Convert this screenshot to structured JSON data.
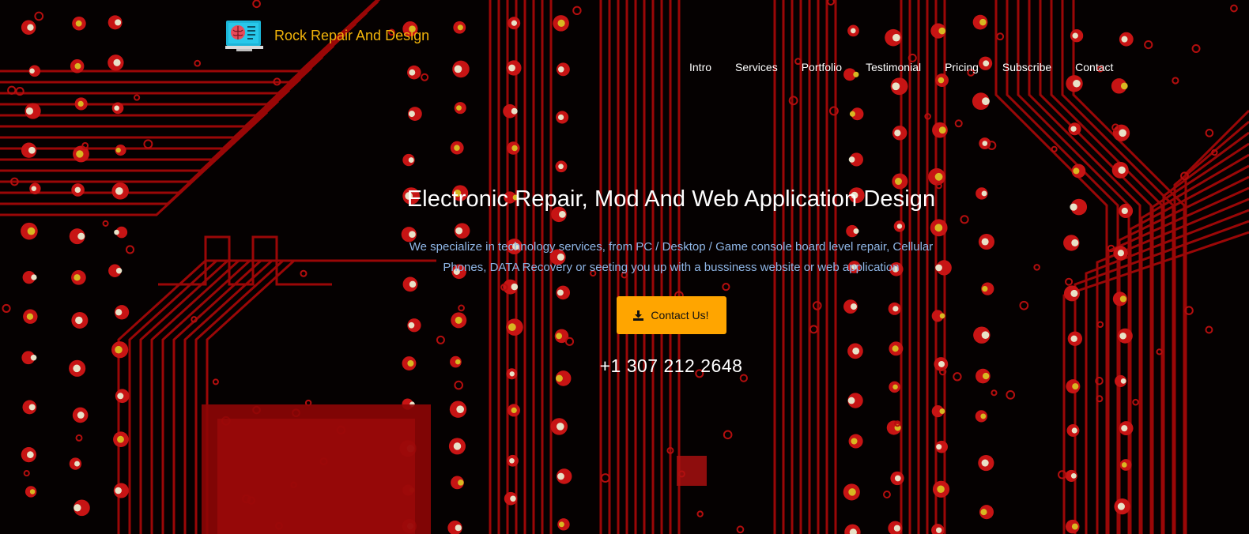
{
  "brand": {
    "name": "Rock Repair And Design",
    "logo_icon": "brain-monitor-icon",
    "color": "#f2b40a"
  },
  "nav": {
    "items": [
      {
        "label": "Intro"
      },
      {
        "label": "Services"
      },
      {
        "label": "Portfolio"
      },
      {
        "label": "Testimonial"
      },
      {
        "label": "Pricing"
      },
      {
        "label": "Subscribe"
      },
      {
        "label": "Contact"
      }
    ]
  },
  "hero": {
    "title": "Electronic Repair, Mod And Web Application Design",
    "description": "We specialize in technology services, from PC / Desktop / Game console board level repair, Cellular Phones, DATA Recovery or seeting you up with a bussiness website or web application",
    "cta_label": "Contact Us!",
    "cta_icon": "download-icon",
    "phone": "+1 307 212 2648"
  },
  "colors": {
    "accent": "#ffa500",
    "background_traces": "#8b0000",
    "description_text": "#8fb6e6"
  }
}
